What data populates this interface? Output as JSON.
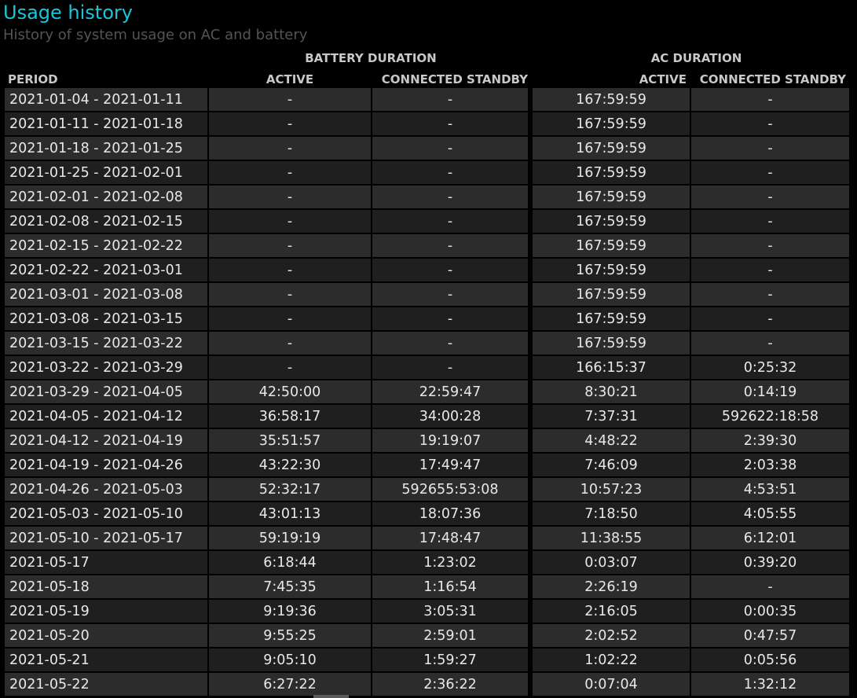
{
  "title": "Usage history",
  "subtitle": "History of system usage on AC and battery",
  "group_headers": {
    "battery": "BATTERY DURATION",
    "ac": "AC DURATION"
  },
  "columns": {
    "period": "PERIOD",
    "battery_active": "ACTIVE",
    "battery_connected_standby": "CONNECTED STANDBY",
    "ac_active": "ACTIVE",
    "ac_connected_standby": "CONNECTED STANDBY"
  },
  "rows": [
    {
      "period": "2021-01-04 - 2021-01-11",
      "battery_active": "-",
      "battery_connected_standby": "-",
      "ac_active": "167:59:59",
      "ac_connected_standby": "-"
    },
    {
      "period": "2021-01-11 - 2021-01-18",
      "battery_active": "-",
      "battery_connected_standby": "-",
      "ac_active": "167:59:59",
      "ac_connected_standby": "-"
    },
    {
      "period": "2021-01-18 - 2021-01-25",
      "battery_active": "-",
      "battery_connected_standby": "-",
      "ac_active": "167:59:59",
      "ac_connected_standby": "-"
    },
    {
      "period": "2021-01-25 - 2021-02-01",
      "battery_active": "-",
      "battery_connected_standby": "-",
      "ac_active": "167:59:59",
      "ac_connected_standby": "-"
    },
    {
      "period": "2021-02-01 - 2021-02-08",
      "battery_active": "-",
      "battery_connected_standby": "-",
      "ac_active": "167:59:59",
      "ac_connected_standby": "-"
    },
    {
      "period": "2021-02-08 - 2021-02-15",
      "battery_active": "-",
      "battery_connected_standby": "-",
      "ac_active": "167:59:59",
      "ac_connected_standby": "-"
    },
    {
      "period": "2021-02-15 - 2021-02-22",
      "battery_active": "-",
      "battery_connected_standby": "-",
      "ac_active": "167:59:59",
      "ac_connected_standby": "-"
    },
    {
      "period": "2021-02-22 - 2021-03-01",
      "battery_active": "-",
      "battery_connected_standby": "-",
      "ac_active": "167:59:59",
      "ac_connected_standby": "-"
    },
    {
      "period": "2021-03-01 - 2021-03-08",
      "battery_active": "-",
      "battery_connected_standby": "-",
      "ac_active": "167:59:59",
      "ac_connected_standby": "-"
    },
    {
      "period": "2021-03-08 - 2021-03-15",
      "battery_active": "-",
      "battery_connected_standby": "-",
      "ac_active": "167:59:59",
      "ac_connected_standby": "-"
    },
    {
      "period": "2021-03-15 - 2021-03-22",
      "battery_active": "-",
      "battery_connected_standby": "-",
      "ac_active": "167:59:59",
      "ac_connected_standby": "-"
    },
    {
      "period": "2021-03-22 - 2021-03-29",
      "battery_active": "-",
      "battery_connected_standby": "-",
      "ac_active": "166:15:37",
      "ac_connected_standby": "0:25:32"
    },
    {
      "period": "2021-03-29 - 2021-04-05",
      "battery_active": "42:50:00",
      "battery_connected_standby": "22:59:47",
      "ac_active": "8:30:21",
      "ac_connected_standby": "0:14:19"
    },
    {
      "period": "2021-04-05 - 2021-04-12",
      "battery_active": "36:58:17",
      "battery_connected_standby": "34:00:28",
      "ac_active": "7:37:31",
      "ac_connected_standby": "592622:18:58"
    },
    {
      "period": "2021-04-12 - 2021-04-19",
      "battery_active": "35:51:57",
      "battery_connected_standby": "19:19:07",
      "ac_active": "4:48:22",
      "ac_connected_standby": "2:39:30"
    },
    {
      "period": "2021-04-19 - 2021-04-26",
      "battery_active": "43:22:30",
      "battery_connected_standby": "17:49:47",
      "ac_active": "7:46:09",
      "ac_connected_standby": "2:03:38"
    },
    {
      "period": "2021-04-26 - 2021-05-03",
      "battery_active": "52:32:17",
      "battery_connected_standby": "592655:53:08",
      "ac_active": "10:57:23",
      "ac_connected_standby": "4:53:51"
    },
    {
      "period": "2021-05-03 - 2021-05-10",
      "battery_active": "43:01:13",
      "battery_connected_standby": "18:07:36",
      "ac_active": "7:18:50",
      "ac_connected_standby": "4:05:55"
    },
    {
      "period": "2021-05-10 - 2021-05-17",
      "battery_active": "59:19:19",
      "battery_connected_standby": "17:48:47",
      "ac_active": "11:38:55",
      "ac_connected_standby": "6:12:01"
    },
    {
      "period": "2021-05-17",
      "battery_active": "6:18:44",
      "battery_connected_standby": "1:23:02",
      "ac_active": "0:03:07",
      "ac_connected_standby": "0:39:20"
    },
    {
      "period": "2021-05-18",
      "battery_active": "7:45:35",
      "battery_connected_standby": "1:16:54",
      "ac_active": "2:26:19",
      "ac_connected_standby": "-"
    },
    {
      "period": "2021-05-19",
      "battery_active": "9:19:36",
      "battery_connected_standby": "3:05:31",
      "ac_active": "2:16:05",
      "ac_connected_standby": "0:00:35"
    },
    {
      "period": "2021-05-20",
      "battery_active": "9:55:25",
      "battery_connected_standby": "2:59:01",
      "ac_active": "2:02:52",
      "ac_connected_standby": "0:47:57"
    },
    {
      "period": "2021-05-21",
      "battery_active": "9:05:10",
      "battery_connected_standby": "1:59:27",
      "ac_active": "1:02:22",
      "ac_connected_standby": "0:05:56"
    },
    {
      "period": "2021-05-22",
      "battery_active": "6:27:22",
      "battery_connected_standby": "2:36:22",
      "ac_active": "0:07:04",
      "ac_connected_standby": "1:32:12"
    }
  ],
  "colors": {
    "background": "#000000",
    "title": "#17c7d9",
    "subtitle": "#545454",
    "header_text": "#c8c8c8",
    "row_odd": "#2c2c2c",
    "row_even": "#1f1f1f",
    "cell_text": "#e8e8e8"
  }
}
